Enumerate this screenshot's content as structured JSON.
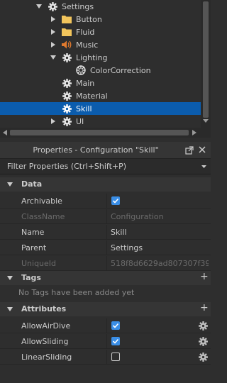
{
  "explorer": {
    "items": [
      {
        "label": "Settings",
        "icon": "gear-icon",
        "expanded": true
      },
      {
        "label": "Button",
        "icon": "folder-icon",
        "expanded": false
      },
      {
        "label": "Fluid",
        "icon": "folder-icon",
        "expanded": false
      },
      {
        "label": "Music",
        "icon": "speaker-icon",
        "expanded": false
      },
      {
        "label": "Lighting",
        "icon": "gear-icon",
        "expanded": true
      },
      {
        "label": "ColorCorrection",
        "icon": "color-correction-icon"
      },
      {
        "label": "Main",
        "icon": "gear-icon"
      },
      {
        "label": "Material",
        "icon": "gear-icon"
      },
      {
        "label": "Skill",
        "icon": "gear-icon",
        "selected": true
      },
      {
        "label": "UI",
        "icon": "gear-icon",
        "expanded": false
      }
    ]
  },
  "properties": {
    "title": "Properties - Configuration \"Skill\"",
    "filter_placeholder": "Filter Properties (Ctrl+Shift+P)",
    "sections": {
      "data": {
        "label": "Data",
        "rows": [
          {
            "name": "Archivable",
            "checked": true
          },
          {
            "name": "ClassName",
            "value": "Configuration",
            "disabled": true
          },
          {
            "name": "Name",
            "value": "Skill"
          },
          {
            "name": "Parent",
            "value": "Settings"
          },
          {
            "name": "UniqueId",
            "value": "518f8d6629ad807307f39...",
            "disabled": true
          }
        ]
      },
      "tags": {
        "label": "Tags",
        "empty_text": "No Tags have been added yet",
        "add": "+"
      },
      "attributes": {
        "label": "Attributes",
        "add": "+",
        "rows": [
          {
            "name": "AllowAirDive",
            "checked": true
          },
          {
            "name": "AllowSliding",
            "checked": true
          },
          {
            "name": "LinearSliding",
            "checked": false
          }
        ]
      }
    }
  },
  "colors": {
    "selection": "#0b5cad",
    "checkbox_on": "#3a8ee6",
    "folder": "#f2c55c",
    "speaker": "#e07a2e"
  }
}
